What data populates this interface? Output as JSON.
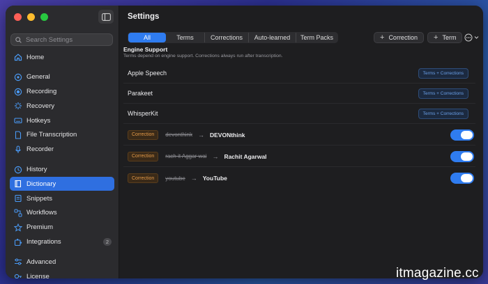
{
  "window": {
    "title": "Settings"
  },
  "sidebar": {
    "search_placeholder": "Search Settings",
    "items": [
      {
        "label": "Home",
        "icon": "home-icon"
      },
      {
        "label": "General",
        "icon": "gear-icon"
      },
      {
        "label": "Recording",
        "icon": "record-icon"
      },
      {
        "label": "Recovery",
        "icon": "recovery-icon"
      },
      {
        "label": "Hotkeys",
        "icon": "keyboard-icon"
      },
      {
        "label": "File Transcription",
        "icon": "file-icon"
      },
      {
        "label": "Recorder",
        "icon": "mic-icon"
      },
      {
        "label": "History",
        "icon": "clock-icon"
      },
      {
        "label": "Dictionary",
        "icon": "book-icon"
      },
      {
        "label": "Snippets",
        "icon": "snippet-icon"
      },
      {
        "label": "Workflows",
        "icon": "workflow-icon"
      },
      {
        "label": "Premium",
        "icon": "star-icon"
      },
      {
        "label": "Integrations",
        "icon": "puzzle-icon",
        "badge": "2"
      },
      {
        "label": "Advanced",
        "icon": "sliders-icon"
      },
      {
        "label": "License",
        "icon": "key-icon"
      }
    ],
    "active": "Dictionary"
  },
  "tabs": [
    "All",
    "Terms",
    "Corrections",
    "Auto-learned",
    "Term Packs"
  ],
  "active_tab": "All",
  "toolbar": {
    "add_correction_label": "Correction",
    "add_term_label": "Term"
  },
  "engine_support": {
    "title": "Engine Support",
    "description": "Terms depend on engine support. Corrections always run after transcription.",
    "engines": [
      {
        "name": "Apple Speech",
        "badge": "Terms + Corrections"
      },
      {
        "name": "Parakeet",
        "badge": "Terms + Corrections"
      },
      {
        "name": "WhisperKit",
        "badge": "Terms + Corrections"
      }
    ]
  },
  "corrections": [
    {
      "tag": "Correction",
      "from": "devonthink",
      "to": "DEVONthink",
      "enabled": true
    },
    {
      "tag": "Correction",
      "from": "rach it Aggar wai",
      "to": "Rachit Agarwal",
      "enabled": true
    },
    {
      "tag": "Correction",
      "from": "youtube",
      "to": "YouTube",
      "enabled": true
    }
  ],
  "watermark": "itmagazine.cc",
  "colors": {
    "accent": "#2f7cf0",
    "correction_tag": "#e49a48",
    "badge_text": "#6aa0e8"
  }
}
